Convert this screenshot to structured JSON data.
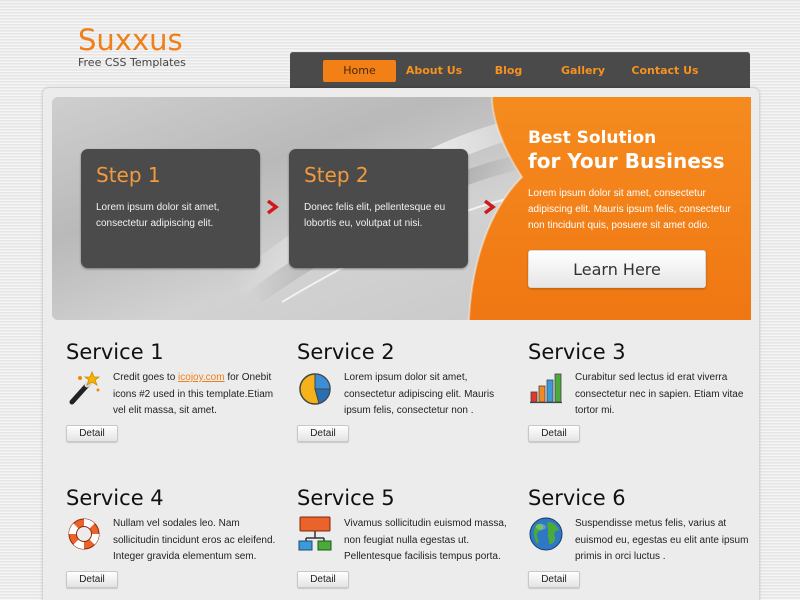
{
  "logo": {
    "title": "Suxxus",
    "subtitle": "Free CSS Templates"
  },
  "nav": {
    "items": [
      {
        "label": "Home",
        "active": true
      },
      {
        "label": "About Us"
      },
      {
        "label": "Blog"
      },
      {
        "label": "Gallery"
      },
      {
        "label": "Contact Us"
      }
    ]
  },
  "banner": {
    "steps": [
      {
        "title": "Step 1",
        "text": "Lorem ipsum dolor sit amet, consectetur adipiscing elit."
      },
      {
        "title": "Step 2",
        "text": "Donec felis elit, pellentesque eu lobortis eu, volutpat ut nisi."
      }
    ],
    "heading1": "Best Solution",
    "heading2": "for Your Business",
    "text": "Lorem ipsum dolor sit amet, consectetur adipiscing elit. Mauris ipsum felis, consectetur non tincidunt quis, posuere sit amet odio.",
    "button": "Learn Here"
  },
  "services": [
    {
      "title": "Service 1",
      "icon": "magic-wand-icon",
      "text_before": "Credit goes to ",
      "link": "icojoy.com",
      "text_after": " for Onebit icons #2 used in this template.Etiam vel elit massa, sit amet.",
      "button": "Detail"
    },
    {
      "title": "Service 2",
      "icon": "pie-chart-icon",
      "text": "Lorem ipsum dolor sit amet, consectetur adipiscing elit. Mauris ipsum felis, consectetur non .",
      "button": "Detail"
    },
    {
      "title": "Service 3",
      "icon": "bar-chart-icon",
      "text": "Curabitur sed lectus id erat viverra consectetur nec in sapien. Etiam vitae tortor mi.",
      "button": "Detail"
    },
    {
      "title": "Service 4",
      "icon": "lifebuoy-icon",
      "text": "Nullam vel sodales leo. Nam sollicitudin tincidunt eros ac eleifend. Integer gravida elementum sem.",
      "button": "Detail"
    },
    {
      "title": "Service 5",
      "icon": "sitemap-icon",
      "text": "Vivamus sollicitudin euismod massa, non feugiat nulla egestas ut. Pellentesque facilisis tempus porta.",
      "button": "Detail"
    },
    {
      "title": "Service 6",
      "icon": "globe-icon",
      "text": "Suspendisse metus felis, varius at euismod eu, egestas eu elit ante ipsum primis in orci luctus .",
      "button": "Detail"
    }
  ],
  "colors": {
    "accent": "#f37f17",
    "nav_bg": "#4a4a4a",
    "step_bg": "#4b4b4b"
  }
}
